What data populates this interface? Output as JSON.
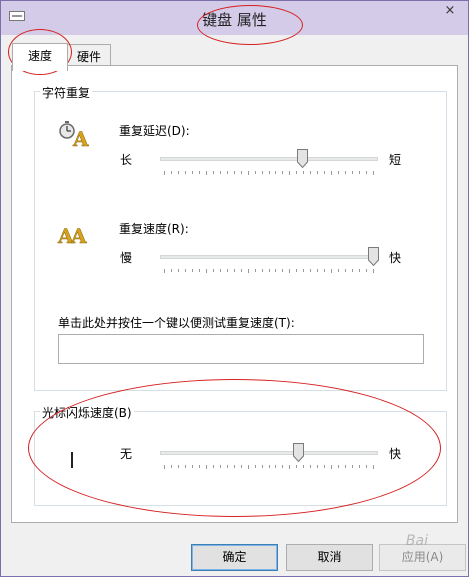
{
  "window": {
    "title": "键盘 属性",
    "close_glyph": "×"
  },
  "tabs": [
    {
      "label": "速度"
    },
    {
      "label": "硬件"
    }
  ],
  "repeat_group": {
    "title": "字符重复",
    "delay": {
      "label": "重复延迟(D):",
      "left": "长",
      "right": "短",
      "value_fraction": 0.65
    },
    "rate": {
      "label": "重复速度(R):",
      "left": "慢",
      "right": "快",
      "value_fraction": 1.0
    },
    "test": {
      "label": "单击此处并按住一个键以便测试重复速度(T):",
      "value": ""
    }
  },
  "blink_group": {
    "title": "光标闪烁速度(B)",
    "left": "无",
    "right": "快",
    "value_fraction": 0.63
  },
  "buttons": {
    "ok": "确定",
    "cancel": "取消",
    "apply": "应用(A)"
  },
  "watermark": "Bai",
  "colors": {
    "annotation": "#d62020",
    "accent": "#3c7fb1"
  }
}
